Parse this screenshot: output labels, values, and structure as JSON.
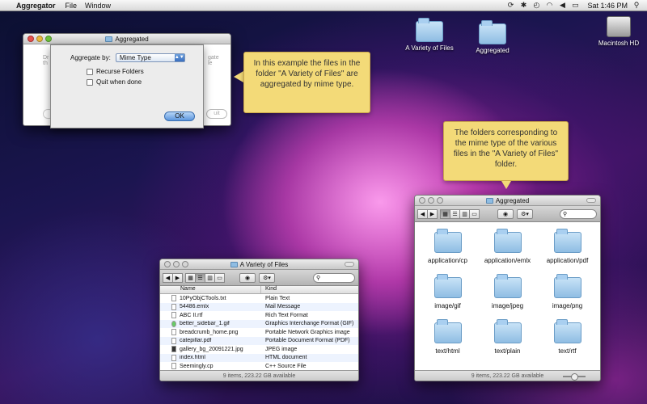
{
  "menubar": {
    "app_name": "Aggregator",
    "items": [
      "File",
      "Window"
    ],
    "clock": "Sat 1:46 PM"
  },
  "desktop": {
    "icons": [
      {
        "label": "A Variety of Files"
      },
      {
        "label": "Aggregated"
      },
      {
        "label": "Macintosh HD"
      }
    ]
  },
  "agg_window": {
    "title": "Aggregated",
    "bg_text_left": "Dr\nth",
    "bg_text_right": "gate\nle",
    "bg_button": "uit"
  },
  "sheet": {
    "aggregate_label": "Aggregate by:",
    "aggregate_value": "Mime Type",
    "recurse_label": "Recurse Folders",
    "quit_label": "Quit when done",
    "ok_label": "OK"
  },
  "callouts": {
    "first": "In this example the files in the folder \"A Variety of Files\" are aggregated by mime type.",
    "second": "The folders corresponding to the mime type of the various files in the \"A Variety of Files\" folder."
  },
  "files_window": {
    "title": "A Variety of Files",
    "col_name": "Name",
    "col_kind": "Kind",
    "rows": [
      {
        "name": "10PyObjCTools.txt",
        "kind": "Plain Text"
      },
      {
        "name": "54486.emlx",
        "kind": "Mail Message"
      },
      {
        "name": "ABC II.rtf",
        "kind": "Rich Text Format"
      },
      {
        "name": "better_sidebar_1.gif",
        "kind": "Graphics Interchange Format (GIF)"
      },
      {
        "name": "breadcrumb_home.png",
        "kind": "Portable Network Graphics image"
      },
      {
        "name": "catepillar.pdf",
        "kind": "Portable Document Format (PDF)"
      },
      {
        "name": "gallery_bg_20091221.jpg",
        "kind": "JPEG image"
      },
      {
        "name": "index.html",
        "kind": "HTML document"
      },
      {
        "name": "Seemingly.cp",
        "kind": "C++ Source File"
      }
    ],
    "status": "9 items, 223.22 GB available"
  },
  "agg_finder": {
    "title": "Aggregated",
    "folders": [
      "application/cp",
      "application/emlx",
      "application/pdf",
      "image/gif",
      "image/jpeg",
      "image/png",
      "text/html",
      "text/plain",
      "text/rtf"
    ],
    "status": "9 items, 223.22 GB available"
  }
}
